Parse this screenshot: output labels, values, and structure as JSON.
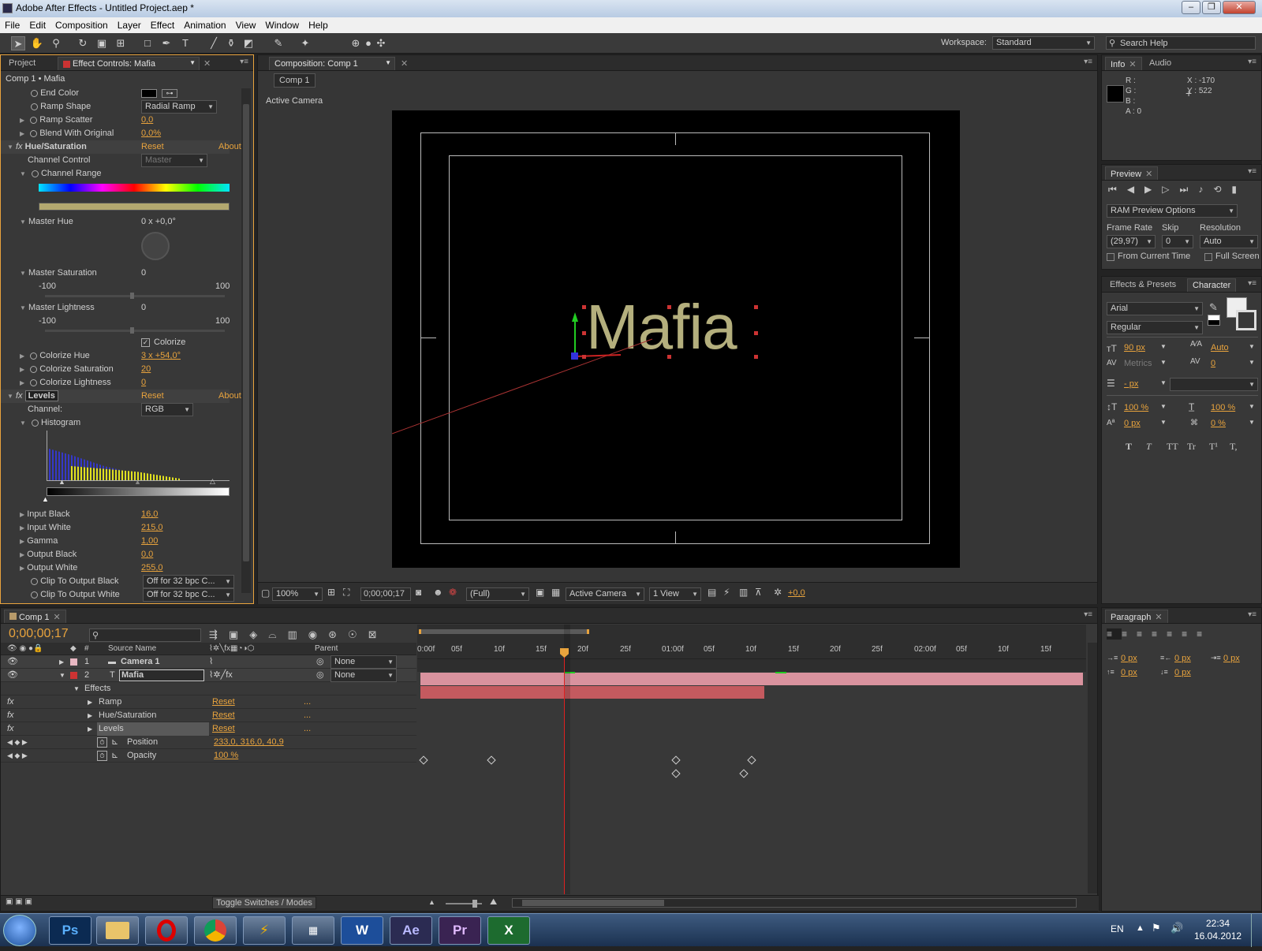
{
  "window": {
    "title": "Adobe After Effects - Untitled Project.aep *"
  },
  "menu": [
    "File",
    "Edit",
    "Composition",
    "Layer",
    "Effect",
    "Animation",
    "View",
    "Window",
    "Help"
  ],
  "workspace": {
    "label": "Workspace:",
    "value": "Standard",
    "search_placeholder": "Search Help"
  },
  "project_panel": {
    "tabs": [
      "Project",
      "Effect Controls: Mafia"
    ],
    "breadcrumb": "Comp 1 • Mafia",
    "rows": [
      {
        "label": "End Color",
        "value": ""
      },
      {
        "label": "Ramp Shape",
        "value": "Radial Ramp"
      },
      {
        "label": "Ramp Scatter",
        "value": "0,0"
      },
      {
        "label": "Blend With Original",
        "value": "0,0%"
      }
    ],
    "hue_sat": {
      "name": "Hue/Saturation",
      "reset": "Reset",
      "about": "About",
      "channel_control": "Channel Control",
      "channel_value": "Master",
      "channel_range": "Channel Range",
      "master_hue": "Master Hue",
      "master_hue_val": "0 x +0,0°",
      "master_sat": "Master Saturation",
      "master_sat_val": "0",
      "master_light": "Master Lightness",
      "master_light_val": "0",
      "min": "-100",
      "max": "100",
      "colorize": "Colorize",
      "colorize_hue": "Colorize Hue",
      "colorize_hue_val": "3 x +54,0°",
      "colorize_sat": "Colorize Saturation",
      "colorize_sat_val": "20",
      "colorize_light": "Colorize Lightness",
      "colorize_light_val": "0"
    },
    "levels": {
      "name": "Levels",
      "reset": "Reset",
      "about": "About",
      "channel": "Channel:",
      "channel_val": "RGB",
      "histogram": "Histogram",
      "input_black": "Input Black",
      "input_black_val": "16,0",
      "input_white": "Input White",
      "input_white_val": "215,0",
      "gamma": "Gamma",
      "gamma_val": "1,00",
      "output_black": "Output Black",
      "output_black_val": "0,0",
      "output_white": "Output White",
      "output_white_val": "255,0",
      "clip_black": "Clip To Output Black",
      "clip_black_val": "Off for 32 bpc C...",
      "clip_white": "Clip To Output White",
      "clip_white_val": "Off for 32 bpc C..."
    }
  },
  "composition": {
    "tab": "Composition: Comp 1",
    "comp_tab": "Comp 1",
    "camera_label": "Active Camera",
    "text": "Mafia",
    "zoom": "100%",
    "timecode": "0;00;00;17",
    "quality": "(Full)",
    "view": "Active Camera",
    "views": "1 View",
    "exposure": "+0,0"
  },
  "info": {
    "tabs": [
      "Info",
      "Audio"
    ],
    "r": "R :",
    "g": "G :",
    "b": "B :",
    "a": "A : 0",
    "x": "X : -170",
    "y": "Y : 522"
  },
  "preview": {
    "tab": "Preview",
    "ram": "RAM Preview Options",
    "frame_rate": "Frame Rate",
    "skip": "Skip",
    "resolution": "Resolution",
    "fr_val": "(29,97)",
    "skip_val": "0",
    "res_val": "Auto",
    "from_current": "From Current Time",
    "full_screen": "Full Screen"
  },
  "character": {
    "tabs": [
      "Effects & Presets",
      "Character"
    ],
    "font": "Arial",
    "style": "Regular",
    "size": "90 px",
    "leading": "Auto",
    "kerning": "Metrics",
    "tracking": "0",
    "stroke": "- px",
    "vscale": "100 %",
    "hscale": "100 %",
    "baseline": "0 px",
    "tsume": "0 %",
    "styles": [
      "T",
      "T",
      "TT",
      "Tr",
      "T¹",
      "T,"
    ]
  },
  "paragraph": {
    "tab": "Paragraph",
    "vals": [
      "0 px",
      "0 px",
      "0 px",
      "0 px",
      "0 px"
    ]
  },
  "timeline": {
    "tab": "Comp 1",
    "timecode": "0;00;00;17",
    "search_placeholder": "",
    "col_num": "#",
    "col_source": "Source Name",
    "col_parent": "Parent",
    "ruler": [
      "0:00f",
      "05f",
      "10f",
      "15f",
      "20f",
      "25f",
      "01:00f",
      "05f",
      "10f",
      "15f",
      "20f",
      "25f",
      "02:00f",
      "05f",
      "10f",
      "15f"
    ],
    "layers": [
      {
        "num": "1",
        "name": "Camera 1",
        "parent": "None"
      },
      {
        "num": "2",
        "name": "Mafia",
        "parent": "None"
      }
    ],
    "effects": "Effects",
    "sub": [
      {
        "name": "Ramp",
        "reset": "Reset",
        "dots": "..."
      },
      {
        "name": "Hue/Saturation",
        "reset": "Reset",
        "dots": "..."
      },
      {
        "name": "Levels",
        "reset": "Reset",
        "dots": "..."
      }
    ],
    "props": [
      {
        "name": "Position",
        "value": "233,0, 316,0, 40,9"
      },
      {
        "name": "Opacity",
        "value": "100 %"
      }
    ],
    "toggle": "Toggle Switches / Modes"
  },
  "taskbar": {
    "apps": [
      "Ps",
      "",
      "",
      "",
      "",
      "",
      "W",
      "Ae",
      "Pr",
      "X"
    ],
    "lang": "EN",
    "time": "22:34",
    "date": "16.04.2012"
  }
}
